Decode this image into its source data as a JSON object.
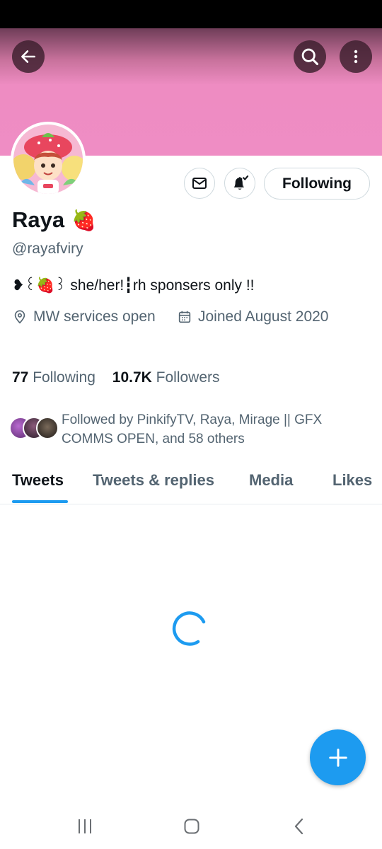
{
  "profile": {
    "name": "Raya",
    "name_emoji": "🍓",
    "handle": "@rayafviry",
    "bio": "❥꒰🍓꒱ she/her!┇rh sponsers only !!",
    "location": "MW services open",
    "joined": "Joined August 2020"
  },
  "actions": {
    "following_label": "Following"
  },
  "stats": {
    "following_count": "77",
    "following_label": "Following",
    "followers_count": "10.7K",
    "followers_label": "Followers"
  },
  "followed_by": {
    "text": "Followed by PinkifyTV, Raya, Mirage || GFX COMMS OPEN, and 58 others"
  },
  "tabs": [
    {
      "label": "Tweets",
      "active": true
    },
    {
      "label": "Tweets & replies",
      "active": false
    },
    {
      "label": "Media",
      "active": false
    },
    {
      "label": "Likes",
      "active": false
    }
  ],
  "icons": {
    "back": "back-arrow-icon",
    "search": "search-icon",
    "more": "more-vertical-icon",
    "message": "envelope-icon",
    "notifications": "bell-icon",
    "location": "location-pin-icon",
    "calendar": "calendar-icon",
    "compose": "plus-icon",
    "nav_recents": "recents-icon",
    "nav_home": "home-icon",
    "nav_back": "nav-back-icon"
  },
  "colors": {
    "banner": "#ef8dc4",
    "accent": "#1d9bf0",
    "text_primary": "#0f1419",
    "text_secondary": "#536471"
  }
}
